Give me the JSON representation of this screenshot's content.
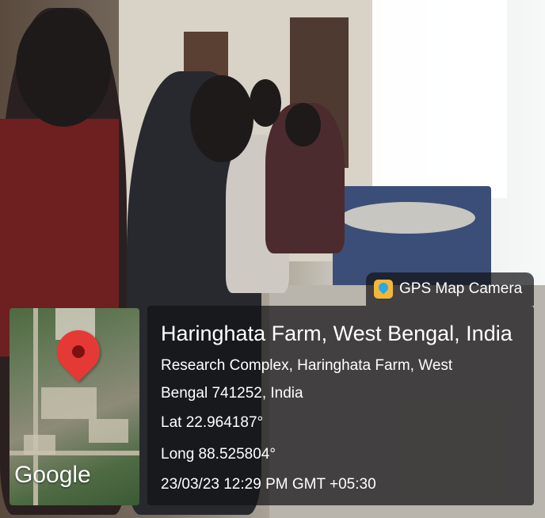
{
  "tag": {
    "app_name": "GPS Map Camera",
    "icon": "gps-map-camera-app-icon"
  },
  "map": {
    "provider_logo": "Google",
    "pin_icon": "location-pin-icon",
    "pin_color": "#e53935"
  },
  "location": {
    "title": "Haringhata Farm, West Bengal, India",
    "address_line1": "Research Complex, Haringhata Farm, West",
    "address_line2": "Bengal 741252, India",
    "lat": "Lat 22.964187°",
    "long": "Long 88.525804°",
    "datetime": "23/03/23 12:29 PM GMT +05:30"
  },
  "colors": {
    "overlay_bg": "rgba(20,20,22,0.72)",
    "text": "#ffffff",
    "accent_icon": "#f2b73a"
  }
}
